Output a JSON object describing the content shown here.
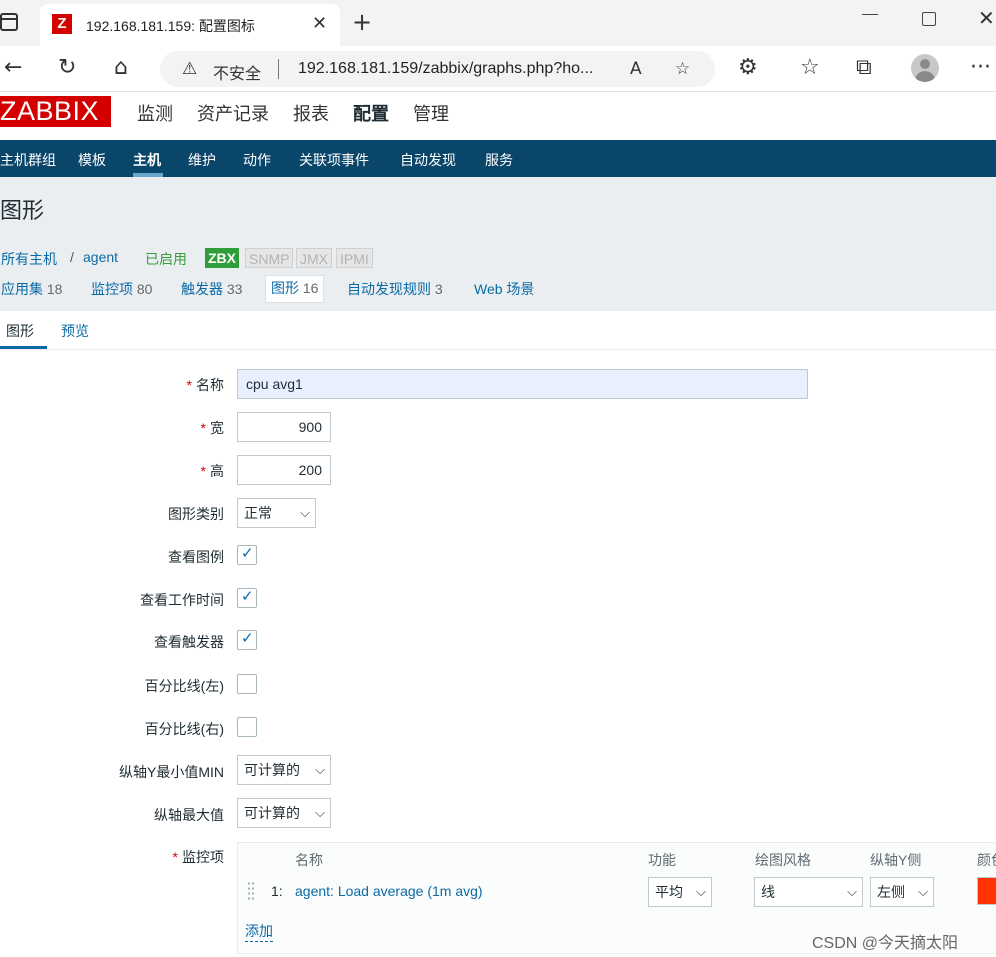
{
  "browser": {
    "tab_title": "192.168.181.159: 配置图标",
    "tab_favicon": "Z",
    "insecure_label": "不安全",
    "url": "192.168.181.159/zabbix/graphs.php?ho..."
  },
  "icons": {
    "window": "window-icon",
    "close": "close-icon",
    "new_tab": "plus-icon",
    "back": "back-arrow-icon",
    "reload": "reload-icon",
    "home": "home-icon",
    "warning": "warning-icon",
    "read_aloud": "read-aloud-icon",
    "favorite": "star-plus-icon",
    "extensions": "puzzle-icon",
    "favorites": "favorites-icon",
    "collections": "collections-icon",
    "profile": "avatar-icon",
    "more": "more-icon"
  },
  "glyphs": {
    "close": "✕",
    "plus": "+",
    "back": "←",
    "reload": "↻",
    "home": "⌂",
    "warning": "⚠",
    "read_aloud": "A",
    "favorite": "☆",
    "extensions": "⚙",
    "favorites": "☆",
    "collections": "⧉",
    "more": "···",
    "chevron": "⌵",
    "check": "✓"
  },
  "zabbix": {
    "logo": "ZABBIX",
    "top_menu": [
      "监测",
      "资产记录",
      "报表",
      "配置",
      "管理"
    ],
    "top_menu_active": "配置",
    "sub_menu": [
      "主机群组",
      "模板",
      "主机",
      "维护",
      "动作",
      "关联项事件",
      "自动发现",
      "服务"
    ],
    "sub_menu_active": "主机"
  },
  "page": {
    "title": "图形",
    "breadcrumb": {
      "all_hosts": "所有主机",
      "sep": "/",
      "host": "agent",
      "status": "已启用"
    },
    "badges": [
      "ZBX",
      "SNMP",
      "JMX",
      "IPMI"
    ],
    "subtabs": [
      {
        "label": "应用集",
        "count": "18"
      },
      {
        "label": "监控项",
        "count": "80"
      },
      {
        "label": "触发器",
        "count": "33"
      },
      {
        "label": "图形",
        "count": "16"
      },
      {
        "label": "自动发现规则",
        "count": "3"
      },
      {
        "label": "Web 场景",
        "count": ""
      }
    ],
    "form_tabs": [
      "图形",
      "预览"
    ]
  },
  "form": {
    "name_label": "名称",
    "name_value": "cpu avg1",
    "width_label": "宽",
    "width_value": "900",
    "height_label": "高",
    "height_value": "200",
    "graph_type_label": "图形类别",
    "graph_type_value": "正常",
    "show_legend_label": "查看图例",
    "show_legend": true,
    "show_work_period_label": "查看工作时间",
    "show_work_period": true,
    "show_triggers_label": "查看触发器",
    "show_triggers": true,
    "percentile_left_label": "百分比线(左)",
    "percentile_left": false,
    "percentile_right_label": "百分比线(右)",
    "percentile_right": false,
    "ymin_label": "纵轴Y最小值MIN",
    "ymin_value": "可计算的",
    "ymax_label": "纵轴最大值",
    "ymax_value": "可计算的",
    "items_label": "监控项",
    "required_mark": "*",
    "items_headers": {
      "name": "名称",
      "function": "功能",
      "draw_style": "绘图风格",
      "y_axis": "纵轴Y侧",
      "color": "颜色"
    },
    "items": [
      {
        "num": "1:",
        "name": "agent: Load average (1m avg)",
        "function": "平均",
        "draw_style": "线",
        "y_axis": "左侧",
        "color": "#ff3300"
      }
    ],
    "add_label": "添加"
  },
  "watermark": "CSDN @今天摘太阳"
}
